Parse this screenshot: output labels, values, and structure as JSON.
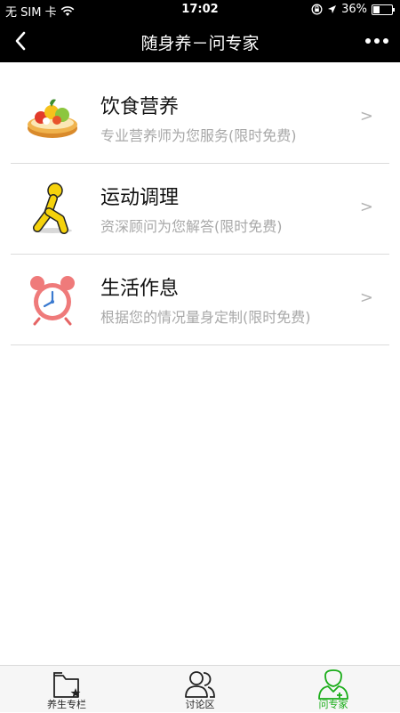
{
  "status_bar": {
    "carrier": "无 SIM 卡",
    "time": "17:02",
    "battery_percent": "36%",
    "battery_level": 0.36,
    "icons": [
      "wifi-icon",
      "orientation-lock-icon",
      "location-arrow-icon",
      "battery-icon"
    ]
  },
  "nav": {
    "title": "随身养－问专家",
    "back_icon": "back-chevron-icon",
    "more_icon": "more-dots-icon"
  },
  "services": [
    {
      "title": "饮食营养",
      "subtitle": "专业营养师为您服务(限时免费)",
      "chevron": ">",
      "icon": "fruit-tart-icon"
    },
    {
      "title": "运动调理",
      "subtitle": "资深顾问为您解答(限时免费)",
      "chevron": ">",
      "icon": "running-man-icon"
    },
    {
      "title": "生活作息",
      "subtitle": "根据您的情况量身定制(限时免费)",
      "chevron": ">",
      "icon": "alarm-clock-icon"
    }
  ],
  "tabbar": {
    "tabs": [
      {
        "label": "养生专栏",
        "icon": "folder-star-icon",
        "active": false
      },
      {
        "label": "讨论区",
        "icon": "people-icon",
        "active": false
      },
      {
        "label": "问专家",
        "icon": "doctor-icon",
        "active": true
      }
    ],
    "active_color": "#1aad19"
  }
}
